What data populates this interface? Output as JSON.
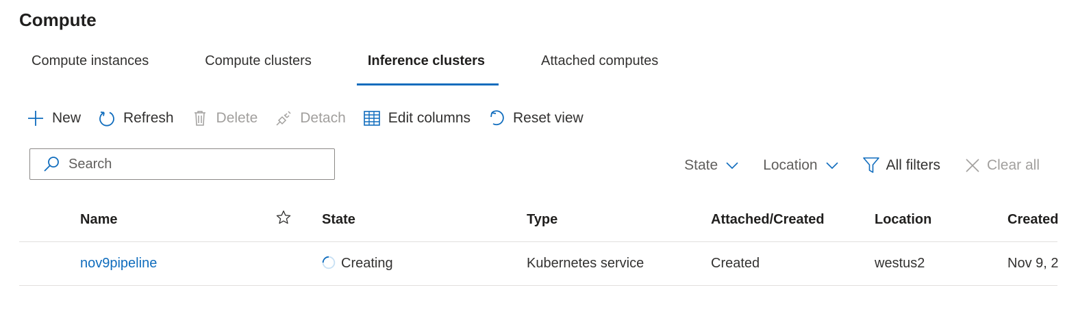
{
  "page": {
    "title": "Compute"
  },
  "tabs": [
    {
      "label": "Compute instances",
      "active": false
    },
    {
      "label": "Compute clusters",
      "active": false
    },
    {
      "label": "Inference clusters",
      "active": true
    },
    {
      "label": "Attached computes",
      "active": false
    }
  ],
  "toolbar": {
    "new_label": "New",
    "refresh_label": "Refresh",
    "delete_label": "Delete",
    "detach_label": "Detach",
    "edit_columns_label": "Edit columns",
    "reset_view_label": "Reset view"
  },
  "search": {
    "placeholder": "Search",
    "value": ""
  },
  "filters": {
    "state_label": "State",
    "location_label": "Location",
    "all_filters_label": "All filters",
    "clear_all_label": "Clear all"
  },
  "table": {
    "columns": {
      "name": "Name",
      "state": "State",
      "type": "Type",
      "attached_created": "Attached/Created",
      "location": "Location",
      "created": "Created"
    },
    "rows": [
      {
        "name": "nov9pipeline",
        "state": "Creating",
        "type": "Kubernetes service",
        "attached_created": "Created",
        "location": "westus2",
        "created": "Nov 9, 2"
      }
    ]
  },
  "colors": {
    "accent": "#0f6cbd",
    "text": "#323130",
    "disabled": "#a19f9d",
    "border": "#e1dfdd"
  }
}
